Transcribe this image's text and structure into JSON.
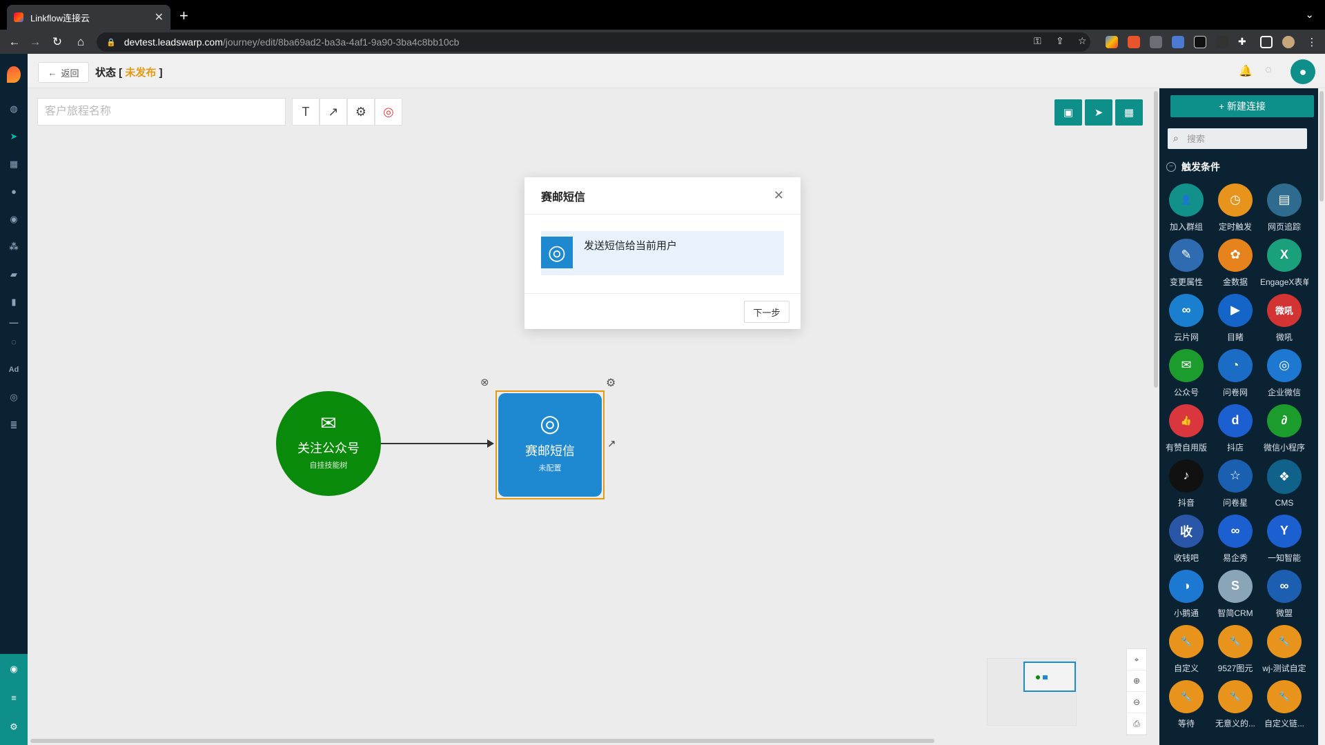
{
  "browser": {
    "tab_title": "Linkflow连接云",
    "url_host": "devtest.leadswarp.com",
    "url_path": "/journey/edit/8ba69ad2-ba3a-4af1-9a90-3ba4c8bb10cb"
  },
  "topbar": {
    "back_label": "返回",
    "status_prefix": "状态 [",
    "status_value": "未发布",
    "status_suffix": "]"
  },
  "canvas": {
    "name_placeholder": "客户旅程名称",
    "start_node": {
      "title": "关注公众号",
      "subtitle": "自挂技能树",
      "color": "#0a8a0a"
    },
    "sms_node": {
      "title": "赛邮短信",
      "subtitle": "未配置",
      "color": "#1e88d0",
      "border": "#e39a12"
    }
  },
  "right_panel": {
    "new_conn_label": "新建连接",
    "search_placeholder": "搜索",
    "section_title": "触发条件",
    "items": [
      {
        "label": "加入群组",
        "color": "#11918a",
        "icon": "user-plus-icon",
        "glyph": "👤"
      },
      {
        "label": "定时触发",
        "color": "#e7931c",
        "icon": "clock-icon",
        "glyph": "◷"
      },
      {
        "label": "网页追踪",
        "color": "#2f6b8f",
        "icon": "webpage-icon",
        "glyph": "▤"
      },
      {
        "label": "变更属性",
        "color": "#2e6bb0",
        "icon": "edit-icon",
        "glyph": "✎"
      },
      {
        "label": "金数据",
        "color": "#e7831c",
        "icon": "leaf-icon",
        "glyph": "✿"
      },
      {
        "label": "EngageX表单",
        "color": "#1aa07a",
        "icon": "engagex-icon",
        "glyph": "X"
      },
      {
        "label": "云片网",
        "color": "#1b7fd0",
        "icon": "cloud-icon",
        "glyph": "∞"
      },
      {
        "label": "目睹",
        "color": "#1565c8",
        "icon": "play-icon",
        "glyph": "▶"
      },
      {
        "label": "微吼",
        "color": "#d23434",
        "icon": "weihou-icon",
        "glyph": "微吼"
      },
      {
        "label": "公众号",
        "color": "#1c9c2c",
        "icon": "wechat-icon",
        "glyph": "✉"
      },
      {
        "label": "问卷网",
        "color": "#1b6cc4",
        "icon": "survey-icon",
        "glyph": "◔"
      },
      {
        "label": "企业微信",
        "color": "#1c78d0",
        "icon": "work-wechat-icon",
        "glyph": "◎"
      },
      {
        "label": "有赞自用版",
        "color": "#d9363e",
        "icon": "thumbs-up-icon",
        "glyph": "👍"
      },
      {
        "label": "抖店",
        "color": "#1b5fd0",
        "icon": "doudian-icon",
        "glyph": "d"
      },
      {
        "label": "微信小程序",
        "color": "#1c9c2c",
        "icon": "mini-program-icon",
        "glyph": "∂"
      },
      {
        "label": "抖音",
        "color": "#111111",
        "icon": "tiktok-icon",
        "glyph": "♪"
      },
      {
        "label": "问卷星",
        "color": "#1b5fb0",
        "icon": "star-icon",
        "glyph": "☆"
      },
      {
        "label": "CMS",
        "color": "#11628a",
        "icon": "cms-icon",
        "glyph": "❖"
      },
      {
        "label": "收钱吧",
        "color": "#2a56a8",
        "icon": "shouqianba-icon",
        "glyph": "收"
      },
      {
        "label": "易企秀",
        "color": "#1b5fd0",
        "icon": "eqxiu-icon",
        "glyph": "∞"
      },
      {
        "label": "一知智能",
        "color": "#1b5fd0",
        "icon": "yizhi-icon",
        "glyph": "Y"
      },
      {
        "label": "小鹅通",
        "color": "#1c78d0",
        "icon": "xiaoe-icon",
        "glyph": "◑"
      },
      {
        "label": "智简CRM",
        "color": "#8aa4b8",
        "icon": "crm-icon",
        "glyph": "S"
      },
      {
        "label": "微盟",
        "color": "#1c5fb0",
        "icon": "weimob-icon",
        "glyph": "∞"
      },
      {
        "label": "自定义",
        "color": "#e7931c",
        "icon": "wrench-icon",
        "glyph": "🔧"
      },
      {
        "label": "9527图元",
        "color": "#e7931c",
        "icon": "wrench-icon",
        "glyph": "🔧"
      },
      {
        "label": "wj-测试自定",
        "color": "#e7931c",
        "icon": "wrench-icon",
        "glyph": "🔧"
      },
      {
        "label": "等待",
        "color": "#e7931c",
        "icon": "wrench-icon",
        "glyph": "🔧"
      },
      {
        "label": "无意义的...",
        "color": "#e7931c",
        "icon": "wrench-icon",
        "glyph": "🔧"
      },
      {
        "label": "自定义链...",
        "color": "#e7931c",
        "icon": "wrench-icon",
        "glyph": "🔧"
      }
    ]
  },
  "modal": {
    "title": "赛邮短信",
    "option_label": "发送短信给当前用户",
    "next_label": "下一步"
  }
}
